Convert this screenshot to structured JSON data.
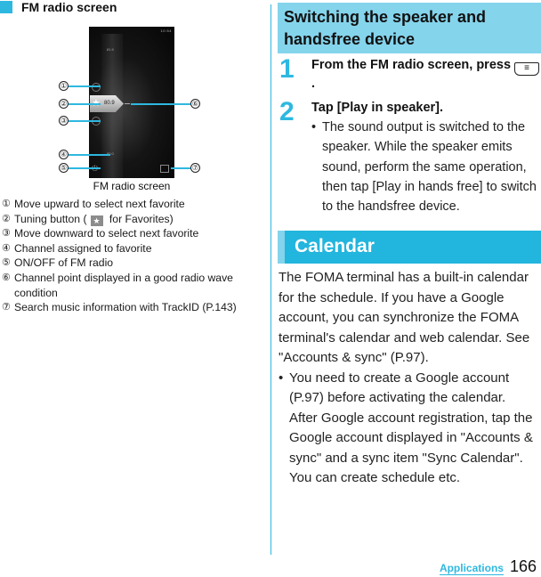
{
  "left": {
    "section_title": "FM radio screen",
    "section_icon": "square-bullet-icon",
    "figure": {
      "caption": "FM radio screen",
      "status_bar": "10:54",
      "freq_top": "81.9",
      "freq_tuned": "80.9",
      "freq_bottom": "80.0",
      "callouts": [
        "①",
        "②",
        "③",
        "④",
        "⑤",
        "⑥",
        "⑦"
      ]
    },
    "legend": [
      {
        "num": "①",
        "text": "Move upward to select next favorite"
      },
      {
        "num": "②",
        "text_before": "Tuning button (",
        "text_after": " for Favorites)",
        "icon": "star"
      },
      {
        "num": "③",
        "text": "Move downward to select next favorite"
      },
      {
        "num": "④",
        "text": "Channel assigned to favorite"
      },
      {
        "num": "⑤",
        "text": "ON/OFF of FM radio"
      },
      {
        "num": "⑥",
        "text": "Channel point displayed in a good radio wave condition"
      },
      {
        "num": "⑦",
        "text": "Search music information with TrackID (P.143)"
      }
    ]
  },
  "right": {
    "heading1": "Switching the speaker and handsfree device",
    "steps": [
      {
        "num": "1",
        "title_before": "From the FM radio screen, press ",
        "key_glyph": "≡",
        "title_after": "."
      },
      {
        "num": "2",
        "title": "Tap [Play in speaker].",
        "bullet": "The sound output is switched to the speaker. While the speaker emits sound, perform the same operation, then tap [Play in hands free] to switch to the handsfree device."
      }
    ],
    "heading2": "Calendar",
    "calendar_intro": "The FOMA terminal has a built-in calendar for the schedule. If you have a Google account, you can synchronize the FOMA terminal's calendar and web calendar. See \"Accounts & sync\" (P.97).",
    "calendar_bullet": "You need to create a Google account (P.97) before activating the calendar.",
    "calendar_bullet_cont": "After Google account registration, tap the Google account displayed in \"Accounts & sync\" and a sync item \"Sync Calendar\". You can create schedule etc."
  },
  "footer": {
    "section": "Applications",
    "page": "166"
  },
  "colors": {
    "accent": "#2eb8e0",
    "heading_light": "#84d4ec",
    "heading_strong": "#22b5dd"
  }
}
